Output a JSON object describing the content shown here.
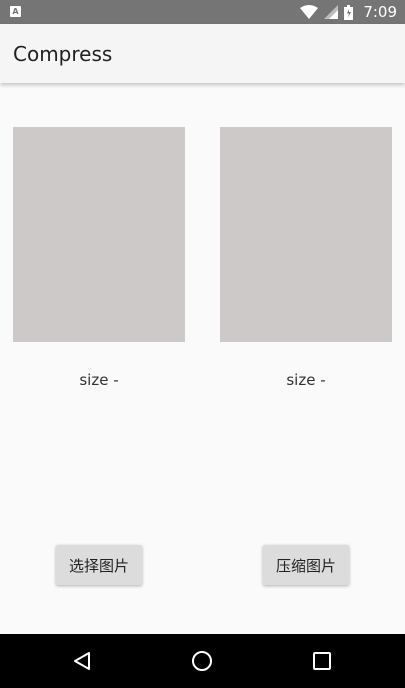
{
  "status_bar": {
    "app_icon_letter": "A",
    "time": "7:09"
  },
  "app_bar": {
    "title": "Compress"
  },
  "images": [
    {
      "size_label": "size -"
    },
    {
      "size_label": "size -"
    }
  ],
  "buttons": {
    "select_label": "选择图片",
    "compress_label": "压缩图片"
  },
  "colors": {
    "status_bar": "#757575",
    "app_bar": "#f5f5f5",
    "image_placeholder": "#cdc9c9",
    "button": "#dcdcdc",
    "nav_bar": "#000000"
  },
  "icons": [
    "wifi-icon",
    "signal-icon",
    "battery-icon",
    "back-icon",
    "home-icon",
    "recents-icon"
  ]
}
